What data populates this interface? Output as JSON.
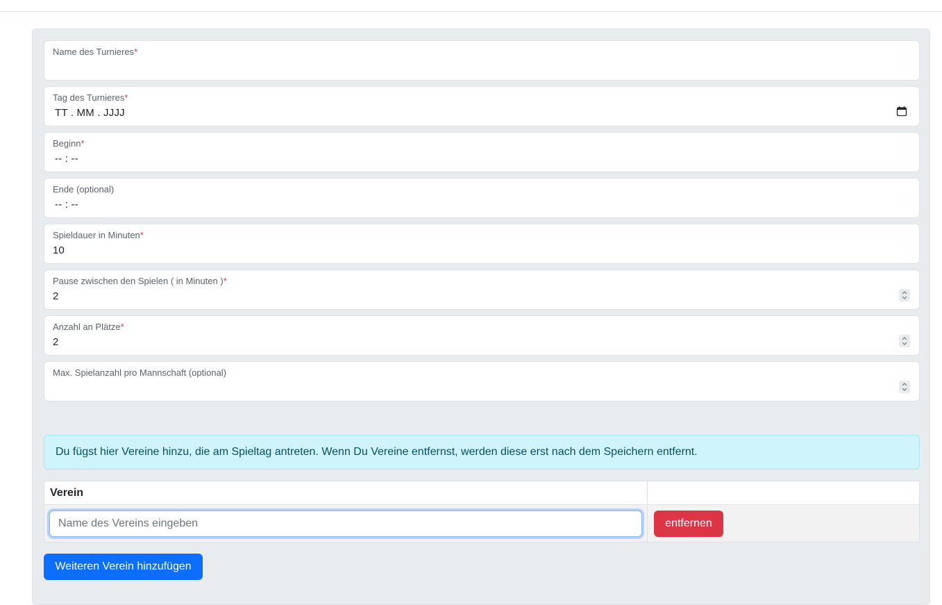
{
  "form": {
    "fields": [
      {
        "label": "Name des Turnieres",
        "required": "*",
        "value": ""
      },
      {
        "label": "Tag des Turnieres",
        "required": "*",
        "value": "TT . MM . JJJJ",
        "icon": "calendar-icon"
      },
      {
        "label": "Beginn",
        "required": "*",
        "value": "-- : --"
      },
      {
        "label": "Ende (optional)",
        "required": "",
        "value": "-- : --"
      },
      {
        "label": "Spieldauer in Minuten",
        "required": "*",
        "value": "10"
      },
      {
        "label": "Pause zwischen den Spielen ( in Minuten )",
        "required": "*",
        "value": "2",
        "icon": "spinner-icon"
      },
      {
        "label": "Anzahl an Plätze",
        "required": "*",
        "value": "2",
        "icon": "spinner-icon"
      },
      {
        "label": "Max. Spielanzahl pro Mannschaft (optional)",
        "required": "",
        "value": "",
        "icon": "spinner-icon"
      }
    ]
  },
  "alert": {
    "text": "Du fügst hier Vereine hinzu, die am Spieltag antreten. Wenn Du Vereine entfernst, werden diese erst nach dem Speichern entfernt."
  },
  "table": {
    "header": "Verein",
    "row": {
      "placeholder": "Name des Vereins eingeben",
      "remove_label": "entfernen"
    }
  },
  "add_button_label": "Weiteren Verein hinzufügen",
  "colors": {
    "required": "#dc3545",
    "alert_bg": "#cff4fc",
    "primary": "#0d6efd",
    "danger": "#dc3545"
  }
}
